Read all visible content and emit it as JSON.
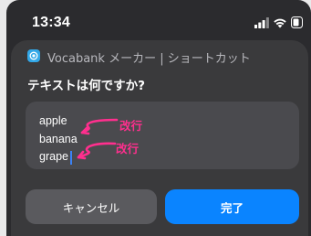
{
  "status_bar": {
    "time": "13:34",
    "icons": [
      "signal-icon",
      "wifi-icon",
      "battery-icon"
    ]
  },
  "dialog": {
    "app_name": "Vocabank メーカー | ショートカット",
    "app_icon": "vocabank-app-icon",
    "question": "テキストは何ですか?",
    "input_lines": [
      "apple",
      "banana",
      "grape"
    ],
    "annotations": [
      "改行",
      "改行"
    ],
    "cancel_label": "キャンセル",
    "done_label": "完了"
  },
  "colors": {
    "sheet": "#3a3a3c",
    "input_bg": "#4a4a4e",
    "annotation": "#ff2f8e",
    "accent": "#0a84ff",
    "caret": "#3b82f6"
  }
}
